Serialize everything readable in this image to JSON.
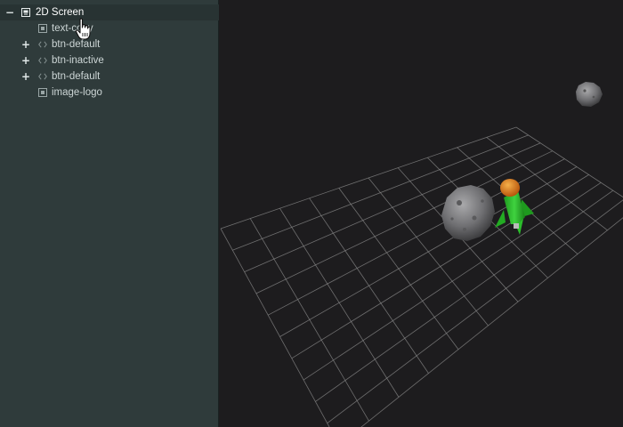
{
  "hierarchy": {
    "items": [
      {
        "label": "2D Screen",
        "toggle": "−",
        "icon": "screen-icon",
        "depth": 0,
        "selected": true
      },
      {
        "label": "text-copy",
        "toggle": "",
        "icon": "text-element-icon",
        "depth": 1
      },
      {
        "label": "btn-default",
        "toggle": "+",
        "icon": "code-brackets-icon",
        "depth": 1
      },
      {
        "label": "btn-inactive",
        "toggle": "+",
        "icon": "code-brackets-icon",
        "depth": 1
      },
      {
        "label": "btn-default",
        "toggle": "+",
        "icon": "code-brackets-icon",
        "depth": 1
      },
      {
        "label": "image-logo",
        "toggle": "",
        "icon": "image-element-icon",
        "depth": 1
      }
    ]
  },
  "viewport": {
    "objects": [
      "grid-floor",
      "asteroid-small",
      "asteroid-large",
      "rocket"
    ]
  },
  "colors": {
    "panel": "#2f3b3b",
    "viewport": "#1d1c1e",
    "grid": "#8a8a8a",
    "rocket_body": "#2bbf2b",
    "rocket_nose": "#e8891c",
    "asteroid": "#8a8a8c"
  }
}
